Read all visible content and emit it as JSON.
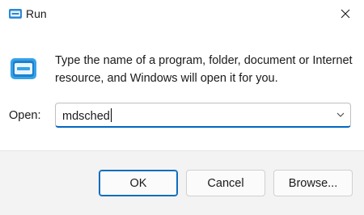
{
  "window": {
    "title": "Run",
    "close_icon": "close-icon",
    "app_icon": "run-icon"
  },
  "dialog": {
    "description": "Type the name of a program, folder, document or Internet resource, and Windows will open it for you.",
    "open_label": "Open:",
    "open_value": "mdsched",
    "dropdown_icon": "chevron-down-icon"
  },
  "buttons": {
    "ok": "OK",
    "cancel": "Cancel",
    "browse": "Browse..."
  },
  "colors": {
    "accent": "#0067c0",
    "footer_bg": "#f3f3f3"
  }
}
